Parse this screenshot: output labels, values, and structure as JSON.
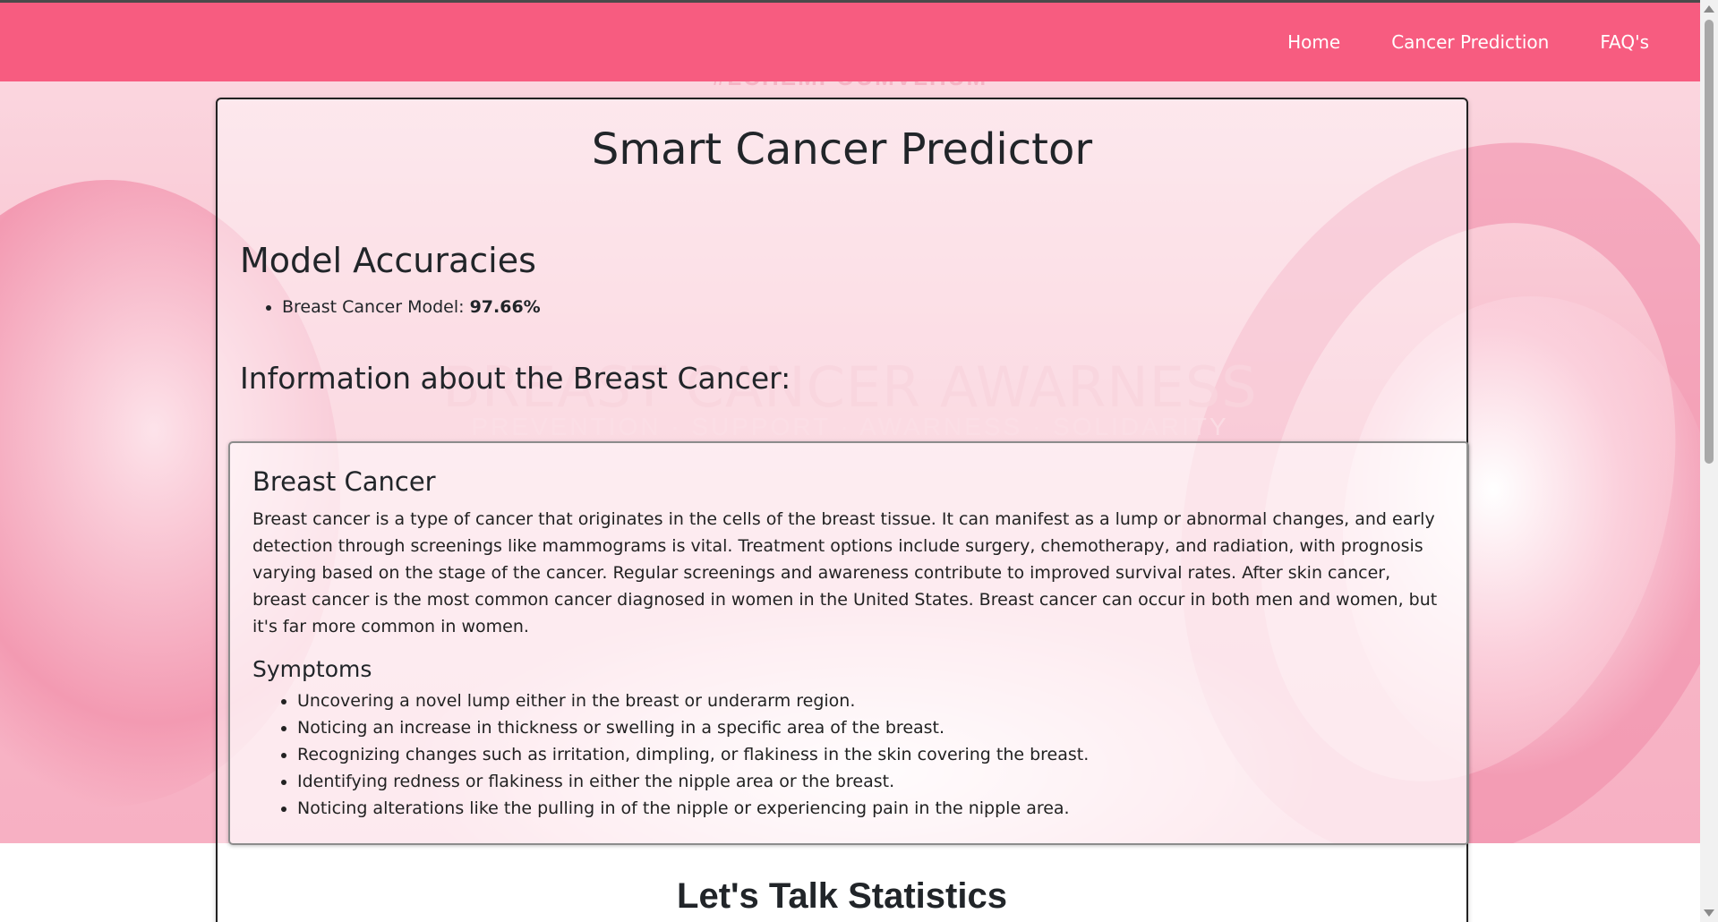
{
  "navbar": {
    "links": [
      "Home",
      "Cancer Prediction",
      "FAQ's"
    ]
  },
  "background": {
    "hashtag": "#LCHEMPOUMVLHUM",
    "awareness": "BREAST CANCER AWARNESS",
    "tagline": "PREVENTION · SUPPORT · AWARNESS · SOLIDARITY"
  },
  "main": {
    "title": "Smart Cancer Predictor",
    "accuracies_heading": "Model Accuracies",
    "accuracies": [
      {
        "label": "Breast Cancer Model: ",
        "value": "97.66%"
      }
    ],
    "info_heading": "Information about the Breast Cancer:",
    "card": {
      "title": "Breast Cancer",
      "description": "Breast cancer is a type of cancer that originates in the cells of the breast tissue. It can manifest as a lump or abnormal changes, and early detection through screenings like mammograms is vital. Treatment options include surgery, chemotherapy, and radiation, with prognosis varying based on the stage of the cancer. Regular screenings and awareness contribute to improved survival rates. After skin cancer, breast cancer is the most common cancer diagnosed in women in the United States. Breast cancer can occur in both men and women, but it's far more common in women.",
      "symptoms_title": "Symptoms",
      "symptoms": [
        "Uncovering a novel lump either in the breast or underarm region.",
        "Noticing an increase in thickness or swelling in a specific area of the breast.",
        "Recognizing changes such as irritation, dimpling, or flakiness in the skin covering the breast.",
        "Identifying redness or flakiness in either the nipple area or the breast.",
        "Noticing alterations like the pulling in of the nipple or experiencing pain in the nipple area."
      ]
    },
    "stats_heading": "Let's Talk Statistics"
  },
  "colors": {
    "navbar": "#f75c80",
    "text": "#212529"
  }
}
